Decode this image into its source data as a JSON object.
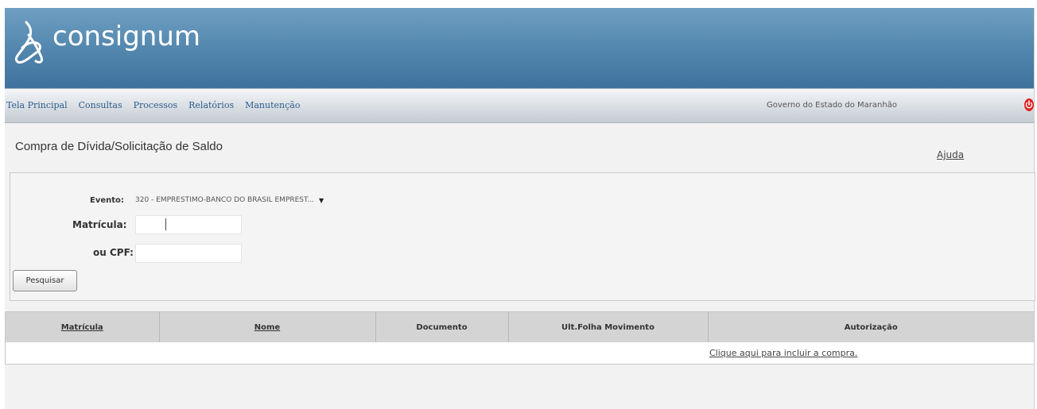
{
  "app": {
    "name": "consignum"
  },
  "nav": {
    "items": [
      {
        "label": "Tela Principal"
      },
      {
        "label": "Consultas"
      },
      {
        "label": "Processos"
      },
      {
        "label": "Relatórios"
      },
      {
        "label": "Manutenção"
      }
    ],
    "organization": "Governo do Estado do Maranhão"
  },
  "page": {
    "title": "Compra de Dívida/Solicitação de Saldo",
    "help_label": "Ajuda"
  },
  "form": {
    "evento": {
      "label": "Evento:",
      "selected": "320 - EMPRESTIMO-BANCO DO BRASIL EMPREST..."
    },
    "matricula": {
      "label": "Matrícula:",
      "value": ""
    },
    "cpf": {
      "label": "ou CPF:",
      "value": ""
    },
    "search_label": "Pesquisar"
  },
  "results": {
    "columns": [
      "Matrícula",
      "Nome",
      "Documento",
      "Ult.Folha Movimento",
      "Autorização"
    ],
    "row": {
      "authorization_link": "Clique aqui para incluir a compra."
    }
  },
  "colors": {
    "header": "#4f83ab",
    "nav_link": "#2c5c8a",
    "power_icon": "#e02020"
  }
}
